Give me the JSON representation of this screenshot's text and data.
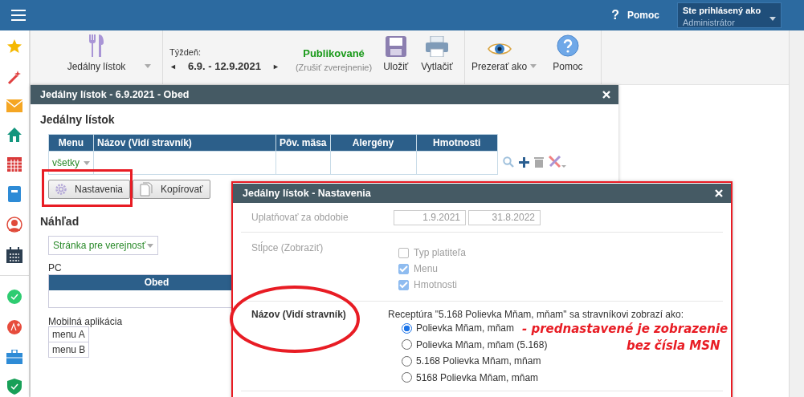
{
  "topbar": {
    "help_icon": "?",
    "help_label": "Pomoc",
    "user": {
      "caption": "Ste prihlásený ako",
      "role": "Administrátor"
    }
  },
  "toolbar": {
    "menu_type": {
      "label": "Jedálny lístok"
    },
    "week": {
      "label": "Týždeň:",
      "prev": "◄",
      "range": "6.9. - 12.9.2021",
      "next": "►"
    },
    "publish": {
      "status": "Publikované",
      "action": "(Zrušiť zverejnenie)"
    },
    "buttons": [
      {
        "kind": "save",
        "label": "Uložiť"
      },
      {
        "kind": "print",
        "label": "Vytlačiť"
      }
    ],
    "view_as": {
      "label": "Prezerať ako"
    },
    "help": {
      "label": "Pomoc"
    }
  },
  "main_dialog": {
    "title": "Jedálny lístok - 6.9.2021 - Obed",
    "section_title": "Jedálny lístok",
    "table": {
      "columns": [
        "Menu",
        "Názov (Vidí stravník)",
        "Pôv. mäsa",
        "Alergény",
        "Hmotnosti"
      ],
      "filter": "všetky"
    },
    "buttons": [
      {
        "kind": "settings",
        "label": "Nastavenia"
      },
      {
        "kind": "copy",
        "label": "Kopírovať"
      }
    ],
    "preview": {
      "title": "Náhľad",
      "audience": "Stránka pre verejnosť",
      "pc_label": "PC",
      "pc_column": "Obed",
      "mobile_label": "Mobilná aplikácia",
      "mobile_items": [
        "menu A",
        "menu B"
      ]
    }
  },
  "settings_dialog": {
    "title": "Jedálny lístok - Nastavenia",
    "period": {
      "label": "Uplatňovať za obdobie",
      "from": "1.9.2021",
      "to": "31.8.2022"
    },
    "columns": {
      "label": "Stĺpce (Zobraziť)",
      "options": [
        {
          "label": "Typ platiteľa",
          "checked": false
        },
        {
          "label": "Menu",
          "checked": true
        },
        {
          "label": "Hmotnosti",
          "checked": true
        }
      ]
    },
    "name": {
      "label": "Názov (Vidí stravník)",
      "intro": "Receptúra \"5.168 Polievka Mňam, mňam\" sa stravníkovi zobrazí ako:",
      "options": [
        {
          "label": "Polievka Mňam, mňam",
          "selected": true
        },
        {
          "label": "Polievka Mňam, mňam (5.168)",
          "selected": false
        },
        {
          "label": "5.168 Polievka Mňam, mňam",
          "selected": false
        },
        {
          "label": "5168 Polievka Mňam, mňam",
          "selected": false
        }
      ]
    }
  },
  "annotation": {
    "lines": [
      "- prednastavené je zobrazenie",
      "bez čísla MSN"
    ]
  }
}
